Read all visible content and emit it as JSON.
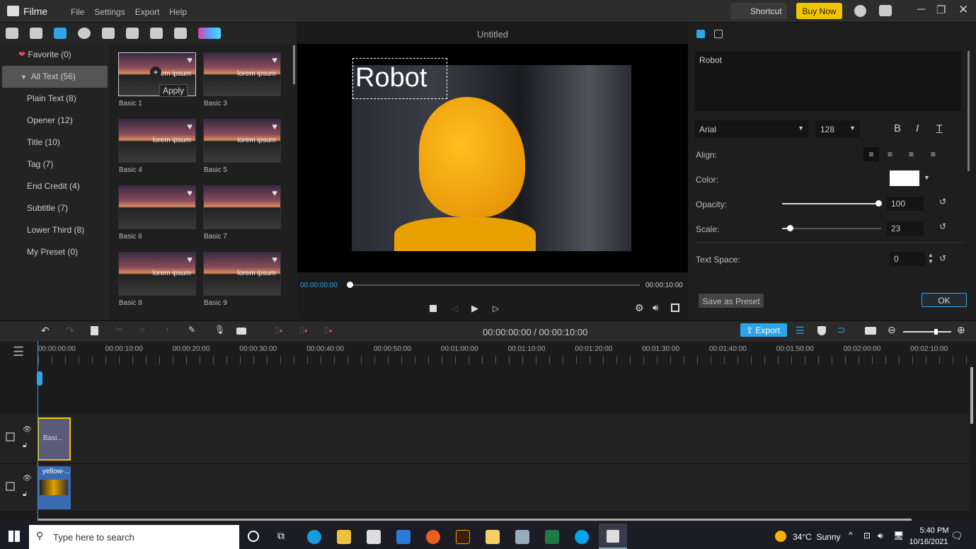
{
  "app": {
    "name": "Filme",
    "menu": [
      "File",
      "Settings",
      "Export",
      "Help"
    ],
    "shortcut": "Shortcut",
    "buy_now": "Buy Now"
  },
  "categories": [
    {
      "label": "Favorite (0)"
    },
    {
      "label": "All Text (56)"
    },
    {
      "label": "Plain Text (8)"
    },
    {
      "label": "Opener (12)"
    },
    {
      "label": "Title (10)"
    },
    {
      "label": "Tag (7)"
    },
    {
      "label": "End Credit (4)"
    },
    {
      "label": "Subtitle (7)"
    },
    {
      "label": "Lower Third (8)"
    },
    {
      "label": "My Preset (0)"
    }
  ],
  "templates": [
    {
      "name": "Basic 1",
      "text": "lorem ipsum"
    },
    {
      "name": "Basic 3",
      "text": "lorem ipsum"
    },
    {
      "name": "Basic 4",
      "text": "lorem ipsum"
    },
    {
      "name": "Basic 5",
      "text": "lorem ipsum"
    },
    {
      "name": "Basic 6",
      "text": ""
    },
    {
      "name": "Basic 7",
      "text": ""
    },
    {
      "name": "Basic 8",
      "text": "lorem ipsum"
    },
    {
      "name": "Basic 9",
      "text": "lorem ipsum"
    }
  ],
  "apply_label": "Apply",
  "preview": {
    "title": "Untitled",
    "overlay_text": "Robot",
    "time_current": "00:00:00:00",
    "time_total": "00:00:10:00",
    "progress": 0
  },
  "props": {
    "text": "Robot",
    "font": "Arial",
    "size": "128",
    "align_label": "Align:",
    "color_label": "Color:",
    "color": "#ffffff",
    "opacity_label": "Opacity:",
    "opacity": "100",
    "scale_label": "Scale:",
    "scale": "23",
    "text_space_label": "Text Space:",
    "text_space": "0",
    "save_preset": "Save as Preset",
    "ok": "OK"
  },
  "timeline": {
    "timecode": "00:00:00:00 / 00:00:10:00",
    "export": "Export",
    "ticks": [
      "00:00:00:00",
      "00:00:10:00",
      "00:00:20:00",
      "00:00:30:00",
      "00:00:40:00",
      "00:00:50:00",
      "00:01:00:00",
      "00:01:10:00",
      "00:01:20:00",
      "00:01:30:00",
      "00:01:40:00",
      "00:01:50:00",
      "00:02:00:00",
      "00:02:10:00"
    ],
    "text_clip": "Basi...",
    "video_clip": "yellow-..."
  },
  "taskbar": {
    "search": "Type here to search",
    "weather": "34°C  Sunny",
    "time": "5:40 PM",
    "date": "10/16/2021"
  },
  "colors": {
    "accent": "#2fa4e7",
    "buy": "#f5c400",
    "favorite": "#e84a5f"
  }
}
